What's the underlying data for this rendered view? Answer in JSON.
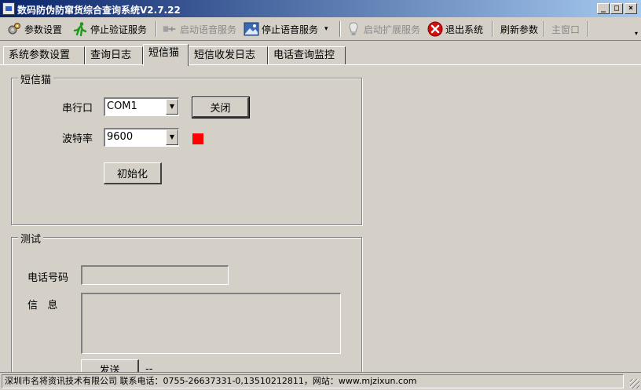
{
  "window": {
    "title": "数码防伪防窜货综合查询系统V2.7.22",
    "controls": {
      "minimize": "_",
      "maximize": "□",
      "close": "×"
    }
  },
  "toolbar": {
    "items": [
      {
        "label": "参数设置",
        "icon": "gears-icon",
        "enabled": true
      },
      {
        "label": "停止验证服务",
        "icon": "running-man-icon",
        "enabled": true
      },
      {
        "label": "启动语音服务",
        "icon": "plug-icon",
        "enabled": false
      },
      {
        "label": "停止语音服务",
        "icon": "picture-icon",
        "enabled": true
      },
      {
        "label": "启动扩展服务",
        "icon": "lightbulb-icon",
        "enabled": false
      },
      {
        "label": "退出系统",
        "icon": "close-circle-icon",
        "enabled": true
      },
      {
        "label": "刷新参数",
        "enabled": true
      },
      {
        "label": "主窗口",
        "enabled": false
      }
    ],
    "dropdown_glyph": "▾",
    "chevron_glyph": "▾"
  },
  "tabs": [
    {
      "label": "系统参数设置",
      "active": false
    },
    {
      "label": "查询日志",
      "active": false
    },
    {
      "label": "短信猫",
      "active": true
    },
    {
      "label": "短信收发日志",
      "active": false
    },
    {
      "label": "电话查询监控",
      "active": false
    }
  ],
  "sms_modem": {
    "group_title": "短信猫",
    "port_label": "串行口",
    "port_value": "COM1",
    "close_button": "关闭",
    "baud_label": "波特率",
    "baud_value": "9600",
    "status_color": "#ff0000",
    "init_button": "初始化"
  },
  "test": {
    "group_title": "测试",
    "phone_label": "电话号码",
    "phone_value": "",
    "message_label": "信   息",
    "message_value": "",
    "send_button": "发送",
    "result_text": "--"
  },
  "status_bar": {
    "text": "深圳市名将资讯技术有限公司 联系电话：0755-26637331-0,13510212811，网站：www.mjzixun.com"
  },
  "colors": {
    "background": "#d4d0c8",
    "title_start": "#0a246a",
    "title_end": "#a6caf0"
  }
}
